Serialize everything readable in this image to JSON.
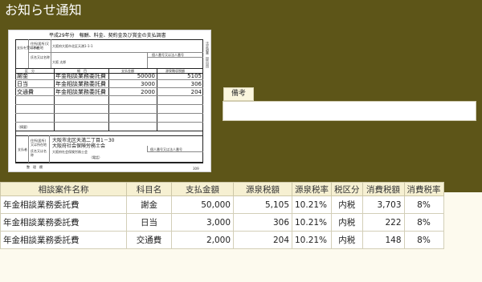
{
  "page_title": "お知らせ通知",
  "document": {
    "title": "平成29年分　報酬、料金、契約金及び賞金の支払調書",
    "payee_address_label": "住所(居所)又は所在地",
    "payee_address": "大阪府大阪市北区天満1-1-1",
    "payee_name_label": "氏名又は名称",
    "payee_name": "大阪 太郎",
    "personal_number_label": "個人番号又は法人番号",
    "col_headers": [
      "区　分",
      "細　目",
      "支払金額",
      "源泉徴収税額"
    ],
    "rows": [
      {
        "category": "謝金",
        "detail": "年金相談業務委託費",
        "amount": "50000",
        "tax": "5105"
      },
      {
        "category": "日当",
        "detail": "年金相談業務委託費",
        "amount": "3000",
        "tax": "306"
      },
      {
        "category": "交通費",
        "detail": "年金相談業務委託費",
        "amount": "2000",
        "tax": "204"
      }
    ],
    "note_label": "（摘要）",
    "payer_label": "支払者",
    "payer_address_label": "住所(居所)又は所在地",
    "payer_address": "大阪市北区天満二丁目1－30",
    "payer_name_label": "氏名又は名称",
    "payer_name": "大阪府社会保険労務士会",
    "payer_name_sub": "大阪府社会保険労務士会",
    "payer_phone_label": "（電話）",
    "footer_label": "整　理　欄",
    "footer_code": "309",
    "side_text": "法定調書（提出用）"
  },
  "remarks": {
    "label": "備考",
    "value": ""
  },
  "table": {
    "headers": [
      "相談案件名称",
      "科目名",
      "支払金額",
      "源泉税額",
      "源泉税率",
      "税区分",
      "消費税額",
      "消費税率"
    ],
    "rows": [
      [
        "年金相談業務委託費",
        "謝金",
        "50,000",
        "5,105",
        "10.21%",
        "内税",
        "3,703",
        "8%"
      ],
      [
        "年金相談業務委託費",
        "日当",
        "3,000",
        "306",
        "10.21%",
        "内税",
        "222",
        "8%"
      ],
      [
        "年金相談業務委託費",
        "交通費",
        "2,000",
        "204",
        "10.21%",
        "内税",
        "148",
        "8%"
      ]
    ]
  }
}
